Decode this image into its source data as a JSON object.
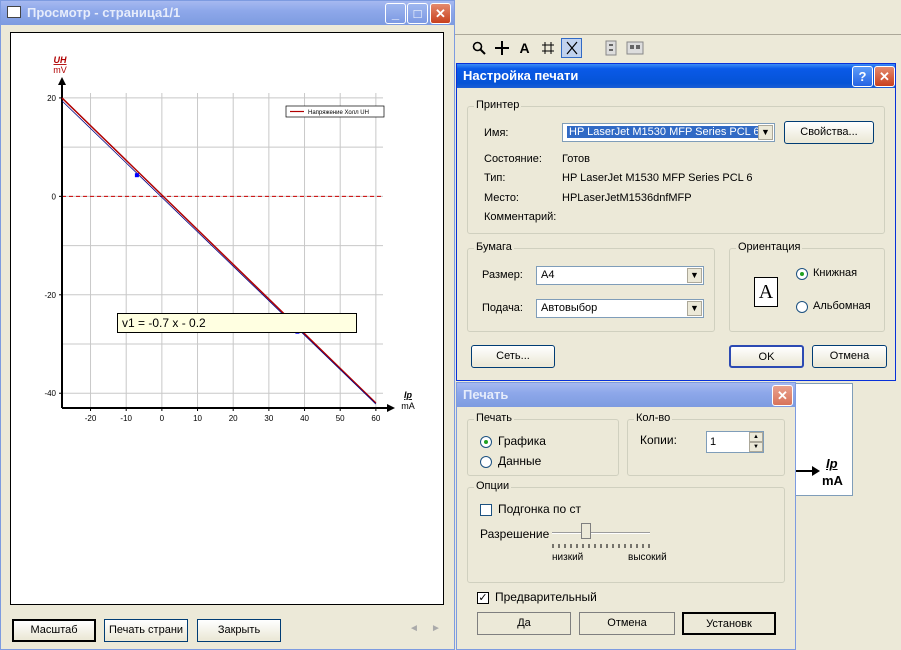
{
  "preview": {
    "title": "Просмотр - страница1/1",
    "buttons": {
      "zoom": "Масштаб",
      "print_page": "Печать страни",
      "close": "Закрыть"
    },
    "nav": {
      "prev": "◄",
      "next": "►"
    }
  },
  "chart_data": {
    "type": "line",
    "ylabel": "UH",
    "yunit": "mV",
    "xlabel": "Ip",
    "xunit": "mA",
    "x_ticks": [
      "-20",
      "-10",
      "0",
      "10",
      "20",
      "30",
      "40",
      "50",
      "60"
    ],
    "y_ticks": [
      "20",
      "0",
      "-20",
      "-40"
    ],
    "xlim": [
      -28,
      62
    ],
    "ylim": [
      -43,
      21
    ],
    "grid": true,
    "legend_position": "top-right",
    "series": [
      {
        "name": "Напряжение Холл UH",
        "color": "#b00000",
        "x": [
          -28,
          60
        ],
        "y": [
          20,
          -42
        ]
      }
    ],
    "fit": {
      "label": "v1 = -0.7 x - 0.2",
      "x": [
        -28,
        60
      ],
      "y": [
        19.4,
        -42.2
      ],
      "color": "#000080"
    },
    "zero_line": {
      "y": 0,
      "color": "#cc0000"
    },
    "markers": [
      {
        "x": -7,
        "y": 4.3
      },
      {
        "x": 38,
        "y": -27.5
      }
    ]
  },
  "setup": {
    "title": "Настройка печати",
    "help": "?",
    "printer_group": "Принтер",
    "name_label": "Имя:",
    "name_value": "HP LaserJet M1530 MFP Series PCL 6",
    "properties_button": "Свойства...",
    "status_label": "Состояние:",
    "status_value": "Готов",
    "type_label": "Тип:",
    "type_value": "HP LaserJet M1530 MFP Series PCL 6",
    "location_label": "Место:",
    "location_value": "HPLaserJetM1536dnfMFP",
    "comment_label": "Комментарий:",
    "paper_group": "Бумага",
    "size_label": "Размер:",
    "size_value": "A4",
    "source_label": "Подача:",
    "source_value": "Автовыбор",
    "orientation_group": "Ориентация",
    "portrait_glyph": "A",
    "portrait": "Книжная",
    "landscape": "Альбомная",
    "network_button": "Сеть...",
    "ok_button": "OK",
    "cancel_button": "Отмена"
  },
  "print": {
    "title": "Печать",
    "print_group": "Печать",
    "graphics": "Графика",
    "data": "Данные",
    "copies_group": "Кол-во",
    "copies_label": "Копии:",
    "copies_value": "1",
    "options_group": "Опции",
    "fit_label": "Подгонка по ст",
    "resolution_label": "Разрешение",
    "resolution_low": "низкий",
    "resolution_high": "высокий",
    "resolution_level": 0.35,
    "preview_label": "Предварительный",
    "yes_button": "Да",
    "cancel_button": "Отмена",
    "setup_button": "Установк"
  },
  "background": {
    "axis_label": "Ip",
    "axis_unit": "mA"
  }
}
